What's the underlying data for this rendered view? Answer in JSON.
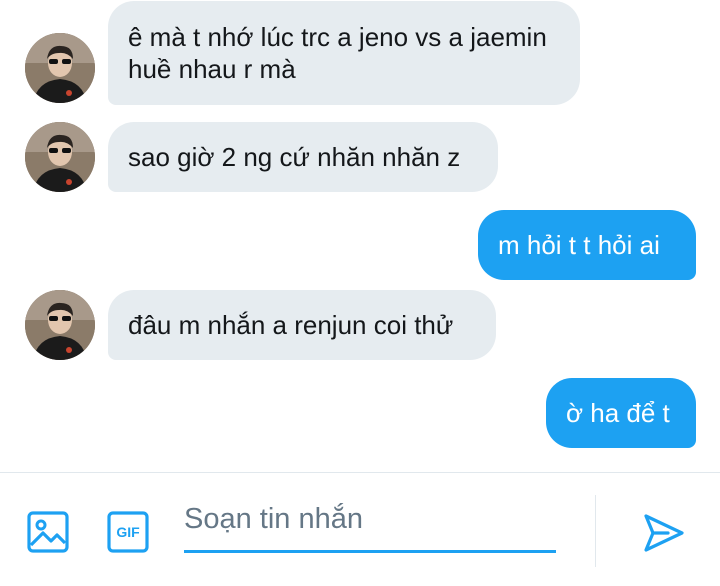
{
  "messages": [
    {
      "direction": "in",
      "text": "ê mà t nhớ lúc trc a jeno vs a jaemin huề nhau r mà"
    },
    {
      "direction": "in",
      "text": "sao giờ 2 ng cứ nhăn nhăn z"
    },
    {
      "direction": "out",
      "text": "m hỏi t t hỏi ai"
    },
    {
      "direction": "in",
      "text": "đâu m nhắn a renjun coi thử"
    },
    {
      "direction": "out",
      "text": "ờ ha để t"
    }
  ],
  "composer": {
    "placeholder": "Soạn tin nhắn",
    "value": "",
    "gif_label": "GIF",
    "image_icon": "image-icon",
    "send_icon": "send-icon"
  },
  "colors": {
    "accent": "#1da1f2",
    "incoming_bubble": "#e6ecf0",
    "incoming_text": "#14171a",
    "outgoing_text": "#ffffff",
    "placeholder": "#657786"
  }
}
